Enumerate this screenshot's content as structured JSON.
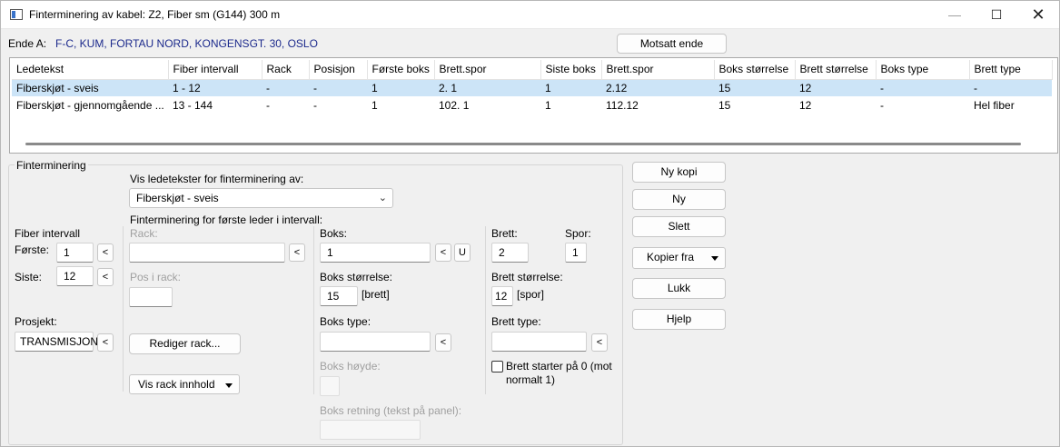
{
  "window": {
    "title": "Finterminering av kabel: Z2, Fiber sm (G144) 300 m",
    "minimize": "—",
    "maximize": "☐",
    "close": "✕"
  },
  "end_a": {
    "label": "Ende A:",
    "value": "F-C, KUM, FORTAU NORD, KONGENSGT. 30, OSLO"
  },
  "motsatt_button": "Motsatt ende",
  "table": {
    "columns": [
      "Ledetekst",
      "Fiber intervall",
      "Rack",
      "Posisjon",
      "Første boks",
      "Brett.spor",
      "Siste boks",
      "Brett.spor",
      "Boks størrelse",
      "Brett størrelse",
      "Boks type",
      "Brett type"
    ],
    "rows": [
      [
        "Fiberskjøt - sveis",
        "1 - 12",
        "-",
        "-",
        "1",
        "2. 1",
        "1",
        "2.12",
        "15",
        "12",
        "-",
        "-"
      ],
      [
        "Fiberskjøt - gjennomgående ...",
        "13 - 144",
        "-",
        "-",
        "1",
        "102. 1",
        "1",
        "112.12",
        "15",
        "12",
        "-",
        "Hel fiber"
      ]
    ]
  },
  "form": {
    "group_title": "Finterminering",
    "vis_label": "Vis ledetekster for finterminering av:",
    "vis_selected": "Fiberskjøt - sveis",
    "first_leader_label": "Finterminering for første leder i intervall:",
    "fiber_intervall_label": "Fiber intervall",
    "forste_label": "Første:",
    "forste_value": "1",
    "siste_label": "Siste:",
    "siste_value": "12",
    "prosjekt_label": "Prosjekt:",
    "prosjekt_value": "TRANSMISJON",
    "rack_label": "Rack:",
    "rack_value": "",
    "pos_label": "Pos i rack:",
    "pos_value": "",
    "rediger_button": "Rediger rack...",
    "vis_rack_button": "Vis rack innhold",
    "boks_label": "Boks:",
    "boks_value": "1",
    "boks_storrelse_label": "Boks størrelse:",
    "boks_storrelse_value": "15",
    "boks_unit": "[brett]",
    "boks_type_label": "Boks type:",
    "boks_type_value": "",
    "boks_hoyde_label": "Boks høyde:",
    "boks_retning_label": "Boks retning (tekst på panel):",
    "brett_label": "Brett:",
    "brett_value": "2",
    "spor_label": "Spor:",
    "spor_value": "1",
    "brett_storrelse_label": "Brett størrelse:",
    "brett_storrelse_value": "12",
    "brett_unit": "[spor]",
    "brett_type_label": "Brett type:",
    "brett_type_value": "",
    "brett_starter_label_1": "Brett starter på 0 (mot",
    "brett_starter_label_2": "normalt 1)",
    "arrow": "<",
    "u": "U"
  },
  "actions": {
    "ny_kopi": "Ny kopi",
    "ny": "Ny",
    "slett": "Slett",
    "kopier_fra": "Kopier fra",
    "lukk": "Lukk",
    "hjelp": "Hjelp"
  },
  "colors": {
    "selected_row": "#cce4f7",
    "end_a_text": "#1c2a8c"
  }
}
